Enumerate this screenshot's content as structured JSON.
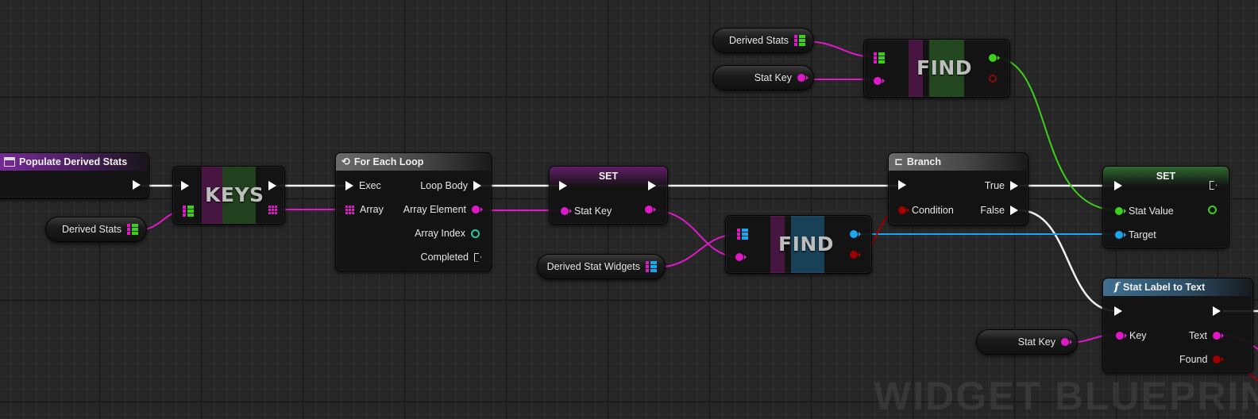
{
  "watermark": "WIDGET BLUEPRINT",
  "event_node": {
    "title": "Populate Derived Stats",
    "icon": "function-box-icon"
  },
  "keys_node": {
    "label": "KEYS"
  },
  "foreach_node": {
    "title": "For Each Loop",
    "icon": "loop-icon",
    "inputs": [
      "Exec",
      "Array"
    ],
    "outputs": [
      "Loop Body",
      "Array Element",
      "Array Index",
      "Completed"
    ]
  },
  "set_node_1": {
    "title": "SET",
    "pin": "Stat Key"
  },
  "find_node_top": {
    "label": "FIND"
  },
  "find_node_mid": {
    "label": "FIND"
  },
  "branch_node": {
    "title": "Branch",
    "icon": "branch-icon",
    "input": "Condition",
    "outputs": [
      "True",
      "False"
    ]
  },
  "set_node_2": {
    "title": "SET",
    "pins": [
      "Stat Value",
      "Target"
    ]
  },
  "func_node": {
    "title": "Stat Label to Text",
    "icon": "function-icon",
    "input": "Key",
    "outputs": [
      "Text",
      "Found"
    ]
  },
  "variables": {
    "derived_stats_left": "Derived Stats",
    "derived_stats_top": "Derived Stats",
    "stat_key_top": "Stat Key",
    "derived_stat_widgets": "Derived Stat Widgets",
    "stat_key_bottom": "Stat Key"
  },
  "colors": {
    "exec": "#ffffff",
    "name_pin": "#e019c8",
    "float_pin": "#3cd01a",
    "object_pin": "#1aa6ee",
    "bool_pin": "#a00000",
    "int_pin": "#1fc9a0"
  }
}
